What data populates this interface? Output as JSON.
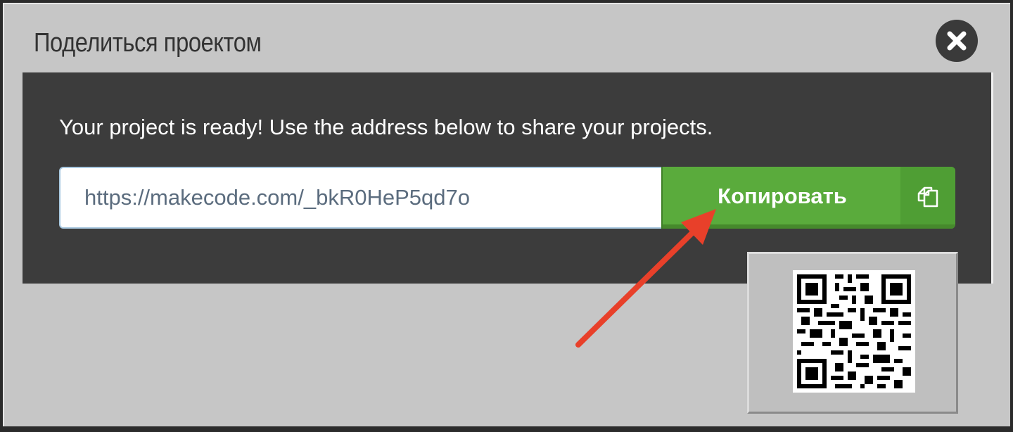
{
  "dialog": {
    "title": "Поделиться проектом",
    "close_icon": "close-icon",
    "message": "Your project is ready! Use the address below to share your projects.",
    "share_url": "https://makecode.com/_bkR0HeP5qd7o",
    "copy_button_label": "Копировать",
    "copy_icon": "copy-icon",
    "qr_icon": "qr-code"
  },
  "annotation": {
    "arrow_color": "#e8402a"
  },
  "colors": {
    "dialog_bg": "#c6c6c6",
    "panel_bg": "#3c3c3c",
    "copy_button": "#5aab3c"
  }
}
